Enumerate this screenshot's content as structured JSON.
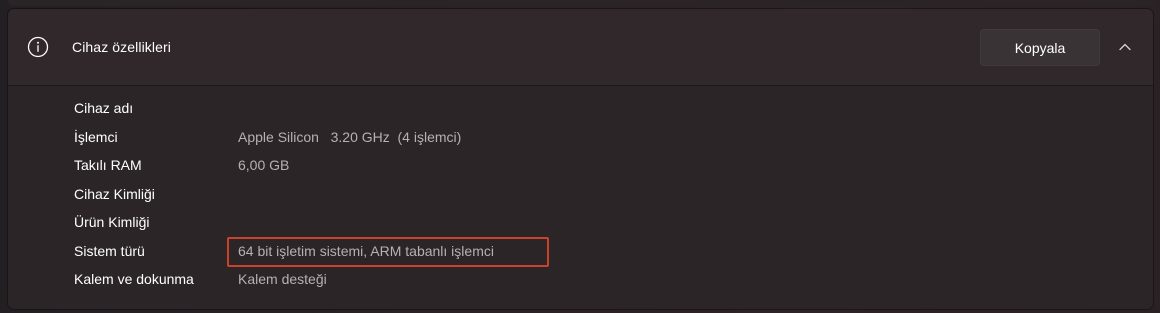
{
  "header": {
    "icon": "info-icon",
    "title": "Cihaz özellikleri",
    "copy_label": "Kopyala",
    "collapse_icon": "chevron-up-icon"
  },
  "specs": [
    {
      "label": "Cihaz adı",
      "value": ""
    },
    {
      "label": "İşlemci",
      "value": "Apple Silicon   3.20 GHz  (4 işlemci)"
    },
    {
      "label": "Takılı RAM",
      "value": "6,00 GB"
    },
    {
      "label": "Cihaz Kimliği",
      "value": ""
    },
    {
      "label": "Ürün Kimliği",
      "value": ""
    },
    {
      "label": "Sistem türü",
      "value": "64 bit işletim sistemi, ARM tabanlı işlemci"
    },
    {
      "label": "Kalem ve dokunma",
      "value": "Kalem desteği"
    }
  ],
  "colors": {
    "highlight": "#c9432c",
    "background": "#2c2528"
  }
}
